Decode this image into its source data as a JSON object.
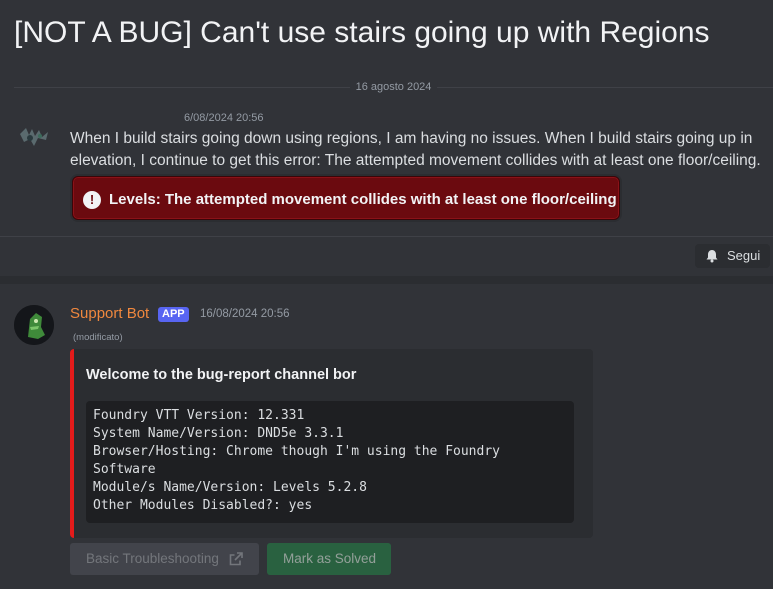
{
  "thread": {
    "title": "[NOT A BUG] Can't use stairs going up with Regions"
  },
  "divider": {
    "date": "16 agosto 2024"
  },
  "message1": {
    "timestamp": "6/08/2024 20:56",
    "body": "When I build stairs going down using regions, I am having no issues. When I build stairs going up in elevation, I continue to get this error: The attempted movement collides with at least one floor/ceiling.",
    "error_icon": "exclamation-circle-icon",
    "error_text": "Levels: The attempted movement collides with at least one floor/ceiling"
  },
  "follow_button": {
    "label": "Segui",
    "icon": "bell-icon"
  },
  "message2": {
    "author": "Support Bot",
    "badge": "APP",
    "timestamp": "16/08/2024 20:56",
    "edited": "(modificato)",
    "embed": {
      "title": "Welcome to the bug-report channel bor",
      "lines": [
        "Foundry VTT Version: 12.331",
        "System Name/Version: DND5e 3.3.1",
        "Browser/Hosting: Chrome though I'm using the Foundry",
        "Software",
        "Module/s Name/Version: Levels 5.2.8",
        "Other Modules Disabled?: yes"
      ]
    },
    "buttons": {
      "troubleshooting": "Basic Troubleshooting",
      "solved": "Mark as Solved"
    }
  },
  "colors": {
    "background": "#313338",
    "author": "#f0883e",
    "badge": "#5865f2",
    "embed_accent": "#e31b1b",
    "error_bg": "#6b0a0f",
    "success": "#248046"
  }
}
